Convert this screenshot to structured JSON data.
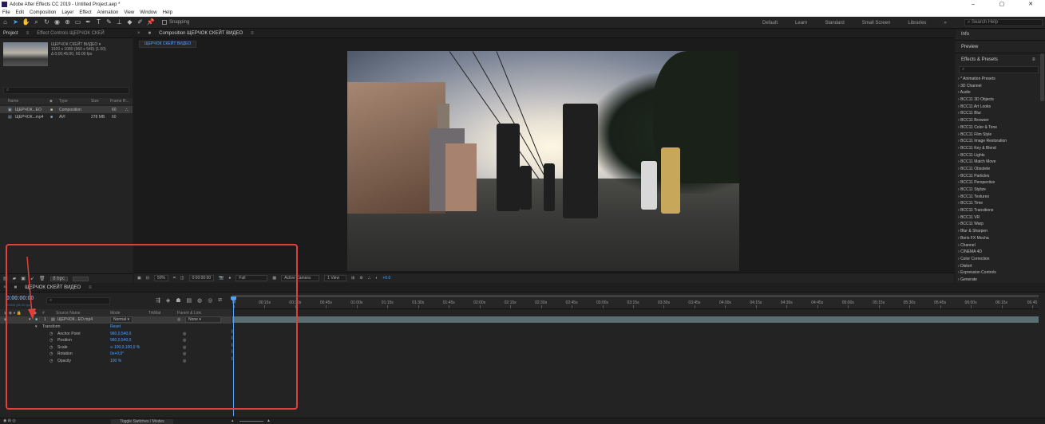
{
  "titlebar": {
    "title": "Adobe After Effects CC 2019 - Untitled Project.aep *",
    "min": "–",
    "max": "▢",
    "close": "✕"
  },
  "menu": [
    "File",
    "Edit",
    "Composition",
    "Layer",
    "Effect",
    "Animation",
    "View",
    "Window",
    "Help"
  ],
  "toolbar": {
    "snapping": "Snapping",
    "workspaces": [
      "Default",
      "Learn",
      "Standard",
      "Small Screen",
      "Libraries"
    ],
    "more": "»",
    "search_help": "Search Help"
  },
  "project": {
    "tab": "Project",
    "effect_controls_tab": "Effect Controls ЩЕРЧОК СКЕЙ",
    "item_name": "ЩЕРЧОК СКЕЙТ ВИДЕО ▾",
    "item_info_1": "1920 x 1080 (960 x 540) (1.00)",
    "item_info_2": "Δ 0;00;45;00, 60.00 fps",
    "search_placeholder": "⌕",
    "columns": {
      "name": "Name",
      "type": "Type",
      "size": "Size",
      "rate": "Frame R..."
    },
    "rows": [
      {
        "name": "ЩЕРЧОК...ЕО",
        "type": "Composition",
        "size": "",
        "rate": "60"
      },
      {
        "name": "ЩЕРЧОК...mp4",
        "type": "AVI",
        "size": "278 MB",
        "rate": "60"
      }
    ],
    "bpc": "8 bpc"
  },
  "composition": {
    "tab": "Composition ЩЕРЧОК СКЕЙТ ВИДЕО",
    "subtab": "ЩЕРЧОК СКЕЙТ ВИДЕО",
    "zoom": "50%",
    "timecode": "0:00:00:00",
    "resolution": "Full",
    "camera": "Active Camera",
    "views": "1 View",
    "exposure": "+0.0"
  },
  "right_panel": {
    "info": "Info",
    "preview": "Preview",
    "effects_presets": "Effects & Presets",
    "search_placeholder": "⌕",
    "items": [
      "* Animation Presets",
      "3D Channel",
      "Audio",
      "BCC11 3D Objects",
      "BCC11 Art Looks",
      "BCC11 Blur",
      "BCC11 Browser",
      "BCC11 Color & Tone",
      "BCC11 Film Style",
      "BCC11 Image Restoration",
      "BCC11 Key & Blend",
      "BCC11 Lights",
      "BCC11 Match Move",
      "BCC11 Obsolete",
      "BCC11 Particles",
      "BCC11 Perspective",
      "BCC11 Stylize",
      "BCC11 Textures",
      "BCC11 Time",
      "BCC11 Transitions",
      "BCC11 VR",
      "BCC11 Warp",
      "Blur & Sharpen",
      "Boris FX Mocha",
      "Channel",
      "CINEMA 4D",
      "Color Correction",
      "Distort",
      "Expression Controls",
      "Generate"
    ]
  },
  "timeline": {
    "tab": "ЩЕРЧОК СКЕЙТ ВИДЕО",
    "timecode": "0:00:00:00",
    "timecode_sub": "00000 (60.00 fps)",
    "search_placeholder": "⌕",
    "columns": {
      "source": "Source Name",
      "mode": "Mode",
      "trkmat": "TrkMat",
      "parent": "Parent & Link"
    },
    "layer": {
      "index": "1",
      "name": "ЩЕРЧОК...ЕО.mp4",
      "mode": "Normal",
      "parent": "None"
    },
    "transform": {
      "label": "Transform",
      "reset": "Reset"
    },
    "properties": [
      {
        "name": "Anchor Point",
        "value": "960,0,540,0"
      },
      {
        "name": "Position",
        "value": "960,0,540,0"
      },
      {
        "name": "Scale",
        "value": "∞ 100,0,100,0 %"
      },
      {
        "name": "Rotation",
        "value": "0x+0,0°"
      },
      {
        "name": "Opacity",
        "value": "100 %"
      }
    ],
    "ruler": [
      "0f",
      "00:15s",
      "00:30s",
      "00:45s",
      "01:00s",
      "01:15s",
      "01:30s",
      "01:45s",
      "02:00s",
      "02:15s",
      "02:30s",
      "02:45s",
      "03:00s",
      "03:15s",
      "03:30s",
      "03:45s",
      "04:00s",
      "04:15s",
      "04:30s",
      "04:45s",
      "05:00s",
      "05:15s",
      "05:30s",
      "05:45s",
      "06:00s",
      "06:15s",
      "06:45"
    ],
    "toggle": "Toggle Switches / Modes"
  },
  "colors": {
    "accent": "#4ea3ff",
    "annotation": "#e0403a"
  }
}
